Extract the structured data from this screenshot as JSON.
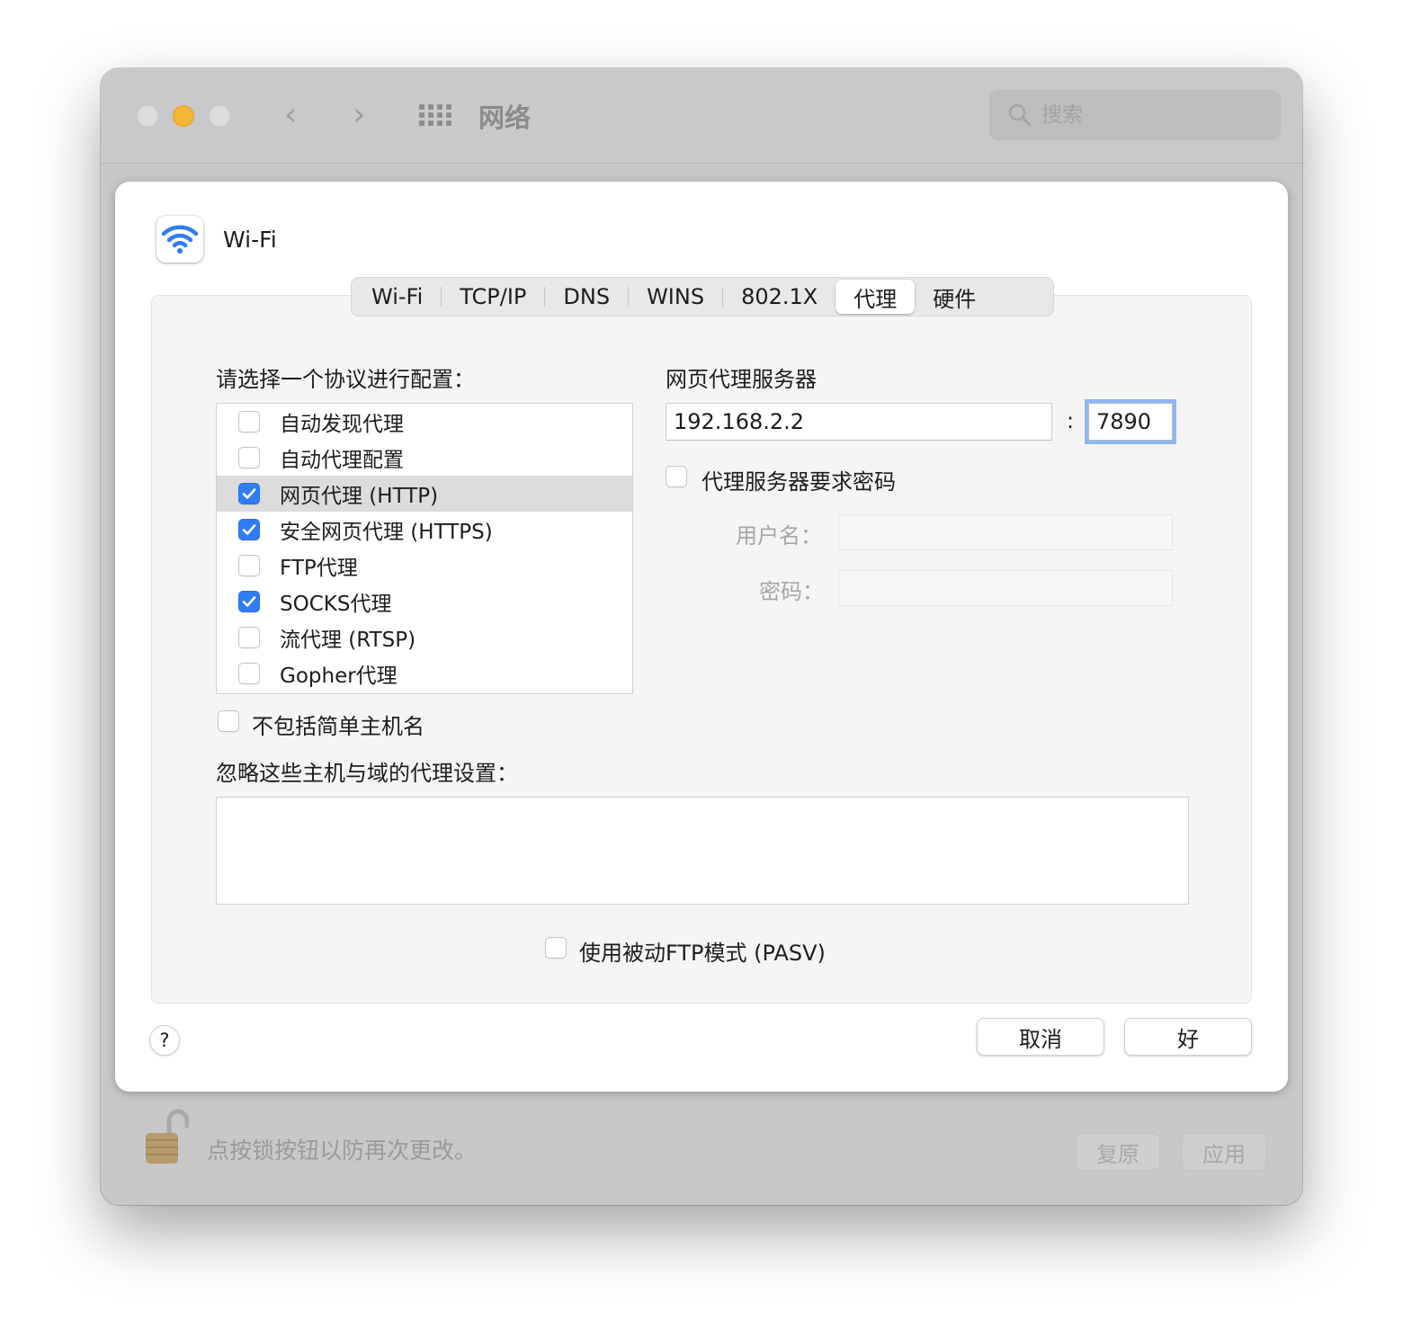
{
  "window": {
    "title": "网络",
    "search_placeholder": "搜索",
    "lock_text": "点按锁按钮以防再次更改。",
    "revert_label": "复原",
    "apply_label": "应用"
  },
  "sheet": {
    "interface_name": "Wi-Fi",
    "tabs": [
      {
        "label": "Wi-Fi",
        "active": false
      },
      {
        "label": "TCP/IP",
        "active": false
      },
      {
        "label": "DNS",
        "active": false
      },
      {
        "label": "WINS",
        "active": false
      },
      {
        "label": "802.1X",
        "active": false
      },
      {
        "label": "代理",
        "active": true
      },
      {
        "label": "硬件",
        "active": false
      }
    ],
    "protocol_prompt": "请选择一个协议进行配置：",
    "protocols": [
      {
        "label": "自动发现代理",
        "checked": false,
        "selected": false
      },
      {
        "label": "自动代理配置",
        "checked": false,
        "selected": false
      },
      {
        "label": "网页代理 (HTTP)",
        "checked": true,
        "selected": true
      },
      {
        "label": "安全网页代理 (HTTPS)",
        "checked": true,
        "selected": false
      },
      {
        "label": "FTP代理",
        "checked": false,
        "selected": false
      },
      {
        "label": "SOCKS代理",
        "checked": true,
        "selected": false
      },
      {
        "label": "流代理 (RTSP)",
        "checked": false,
        "selected": false
      },
      {
        "label": "Gopher代理",
        "checked": false,
        "selected": false
      }
    ],
    "server_heading": "网页代理服务器",
    "server_value": "192.168.2.2",
    "colon": ":",
    "port_value": "7890",
    "require_password_label": "代理服务器要求密码",
    "username_label": "用户名：",
    "password_label": "密码：",
    "exclude_simple_label": "不包括简单主机名",
    "bypass_label": "忽略这些主机与域的代理设置：",
    "bypass_value": "",
    "pasv_label": "使用被动FTP模式 (PASV)",
    "help_label": "?",
    "cancel_label": "取消",
    "ok_label": "好"
  },
  "colors": {
    "accent": "#2f7cf6",
    "focus_ring": "#8db7f7",
    "traffic_minimize": "#f2b634"
  }
}
